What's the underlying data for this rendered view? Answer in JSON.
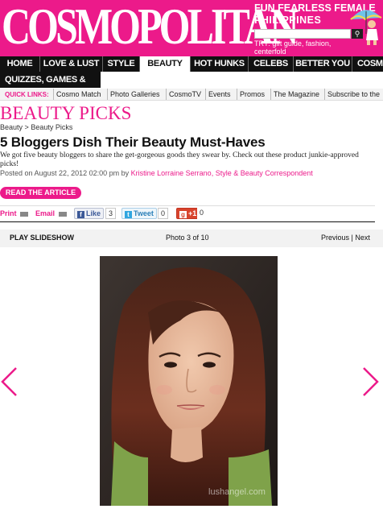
{
  "header": {
    "logo": "COSMOPOLITAN",
    "tagline": "FUN FEARLESS FEMALE",
    "edition": "PHILIPPINES",
    "search_placeholder": "",
    "try_text": "TRY: gift guide, fashion, centerfold"
  },
  "nav": {
    "items": [
      {
        "label": "HOME"
      },
      {
        "label": "LOVE & LUST"
      },
      {
        "label": "STYLE"
      },
      {
        "label": "BEAUTY"
      },
      {
        "label": "HOT HUNKS"
      },
      {
        "label": "CELEBS"
      },
      {
        "label": "BETTER YOU"
      },
      {
        "label": "COSMO"
      }
    ],
    "second_row": "QUIZZES, GAMES & TOOLS",
    "active": "BEAUTY"
  },
  "quick_links": {
    "label": "QUICK LINKS:",
    "items": [
      "Cosmo Match",
      "Photo Galleries",
      "CosmoTV",
      "Events",
      "Promos",
      "The Magazine",
      "Subscribe to the"
    ]
  },
  "article": {
    "section_title": "BEAUTY PICKS",
    "breadcrumb": [
      "Beauty",
      ">",
      "Beauty Picks"
    ],
    "headline": "5 Bloggers Dish Their Beauty Must-Haves",
    "dek": "We got five beauty bloggers to share the get-gorgeous goods they swear by. Check out these product junkie-approved picks!",
    "posted": "Posted on August 22, 2012 02:00 pm by",
    "author": "Kristine Lorraine Serrano, Style & Beauty Correspondent",
    "read_button": "READ THE ARTICLE"
  },
  "share": {
    "print": "Print",
    "email": "Email",
    "like_label": "Like",
    "like_count": "3",
    "tweet_label": "Tweet",
    "tweet_count": "0",
    "plus_label": "+1",
    "plus_count": "0"
  },
  "slideshow": {
    "play_label": "PLAY SLIDESHOW",
    "counter": "Photo 3 of 10",
    "previous": "Previous",
    "separator": "|",
    "next": "Next",
    "watermark": "lushangel.com"
  },
  "colors": {
    "brand": "#ec1a8a",
    "nav_bg": "#111111"
  }
}
